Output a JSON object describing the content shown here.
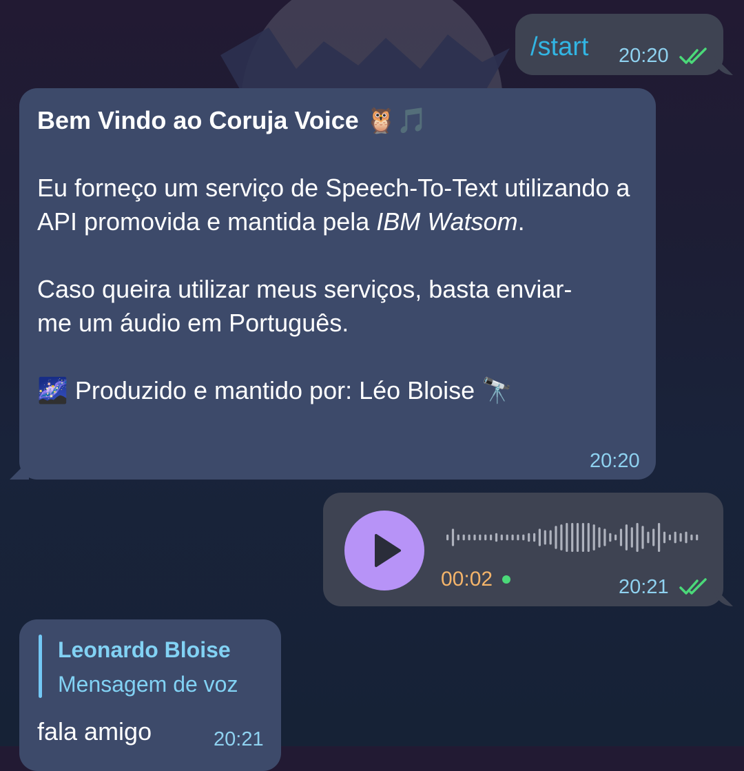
{
  "messages": {
    "start": {
      "text": "/start",
      "time": "20:20",
      "status_icon": "double-check-icon"
    },
    "welcome": {
      "title": "Bem Vindo ao Coruja Voice",
      "title_emoji": "🦉🎵",
      "para1_main": "Eu forneço um serviço de Speech-To-Text utilizando a API promovida e mantida pela ",
      "para1_italic": "IBM Watsom",
      "para1_end": ".",
      "para2": "Caso queira utilizar meus serviços, basta enviar-me um áudio em Português.",
      "credit_emoji_start": "🌌",
      "credit": "Produzido e mantido por: Léo Bloise",
      "credit_emoji_end": "🔭",
      "time": "20:20"
    },
    "voice": {
      "duration": "00:02",
      "time": "20:21",
      "play_icon": "play-icon",
      "status_icon": "double-check-icon",
      "waveform_levels": [
        2,
        6,
        2,
        2,
        2,
        2,
        2,
        2,
        2,
        3,
        2,
        2,
        2,
        2,
        2,
        3,
        3,
        6,
        5,
        5,
        8,
        9,
        10,
        10,
        10,
        10,
        10,
        9,
        7,
        6,
        3,
        2,
        6,
        9,
        7,
        10,
        8,
        4,
        6,
        10,
        4,
        2,
        4,
        3,
        4,
        2,
        2
      ]
    },
    "reply": {
      "quoted_name": "Leonardo Bloise",
      "quoted_text": "Mensagem de voz",
      "text": "fala amigo",
      "time": "20:21"
    }
  },
  "colors": {
    "accent_blue": "#32b5e3",
    "play_button": "#b793f7",
    "check_green": "#4bd979",
    "duration_orange": "#f4b46a"
  }
}
